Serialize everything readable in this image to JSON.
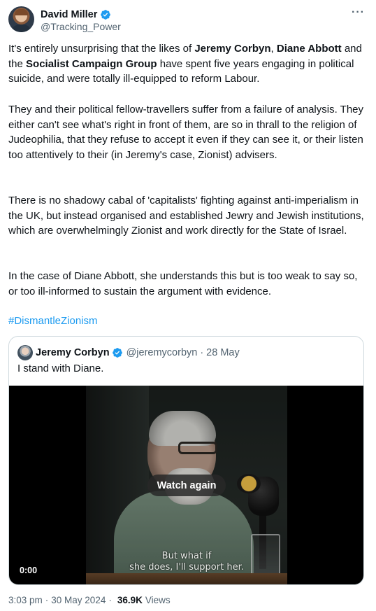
{
  "author": {
    "display_name": "David Miller",
    "handle": "@Tracking_Power",
    "verified_icon": "verified-badge-icon",
    "more_label": "···"
  },
  "body": {
    "p1": {
      "t1": "It's entirely unsurprising that the likes of ",
      "b1": "Jeremy Corbyn",
      "t2": ", ",
      "b2": "Diane Abbott",
      "t3": " and the ",
      "b3": "Socialist Campaign Group",
      "t4": " have spent five years engaging in political suicide, and were totally ill-equipped to reform Labour."
    },
    "p2": "They and their political fellow-travellers suffer from a failure of analysis. They either can't see what's right in front of them, are so in thrall to the religion of Judeophilia, that they refuse to accept it even if they can see it, or their listen too attentively to their (in Jeremy's case, Zionist) advisers.",
    "p3": "There is no shadowy cabal of 'capitalists' fighting against anti-imperialism in the UK, but instead organised and established Jewry and Jewish institutions, which are overwhelmingly Zionist and work directly for the State of Israel.",
    "p4": "In the case of Diane Abbott, she understands this but is too weak to say so, or too ill-informed to sustain the argument with evidence.",
    "hashtag": "#DismantleZionism"
  },
  "quote": {
    "display_name": "Jeremy Corbyn",
    "handle": "@jeremycorbyn",
    "separator": "·",
    "date": "28 May",
    "text": "I stand with Diane.",
    "video": {
      "watch_again_label": "Watch again",
      "subtitle_line1": "But what if",
      "subtitle_line2": "she does, I'll support her.",
      "timer": "0:00"
    }
  },
  "meta": {
    "time": "3:03 pm",
    "separator": "·",
    "date": "30 May 2024",
    "separator2": "·",
    "views_count": "36.9K",
    "views_label": "Views"
  },
  "colors": {
    "link": "#1d9bf0",
    "secondary_text": "#536471",
    "border": "#cfd9de",
    "verified": "#1d9bf0"
  }
}
